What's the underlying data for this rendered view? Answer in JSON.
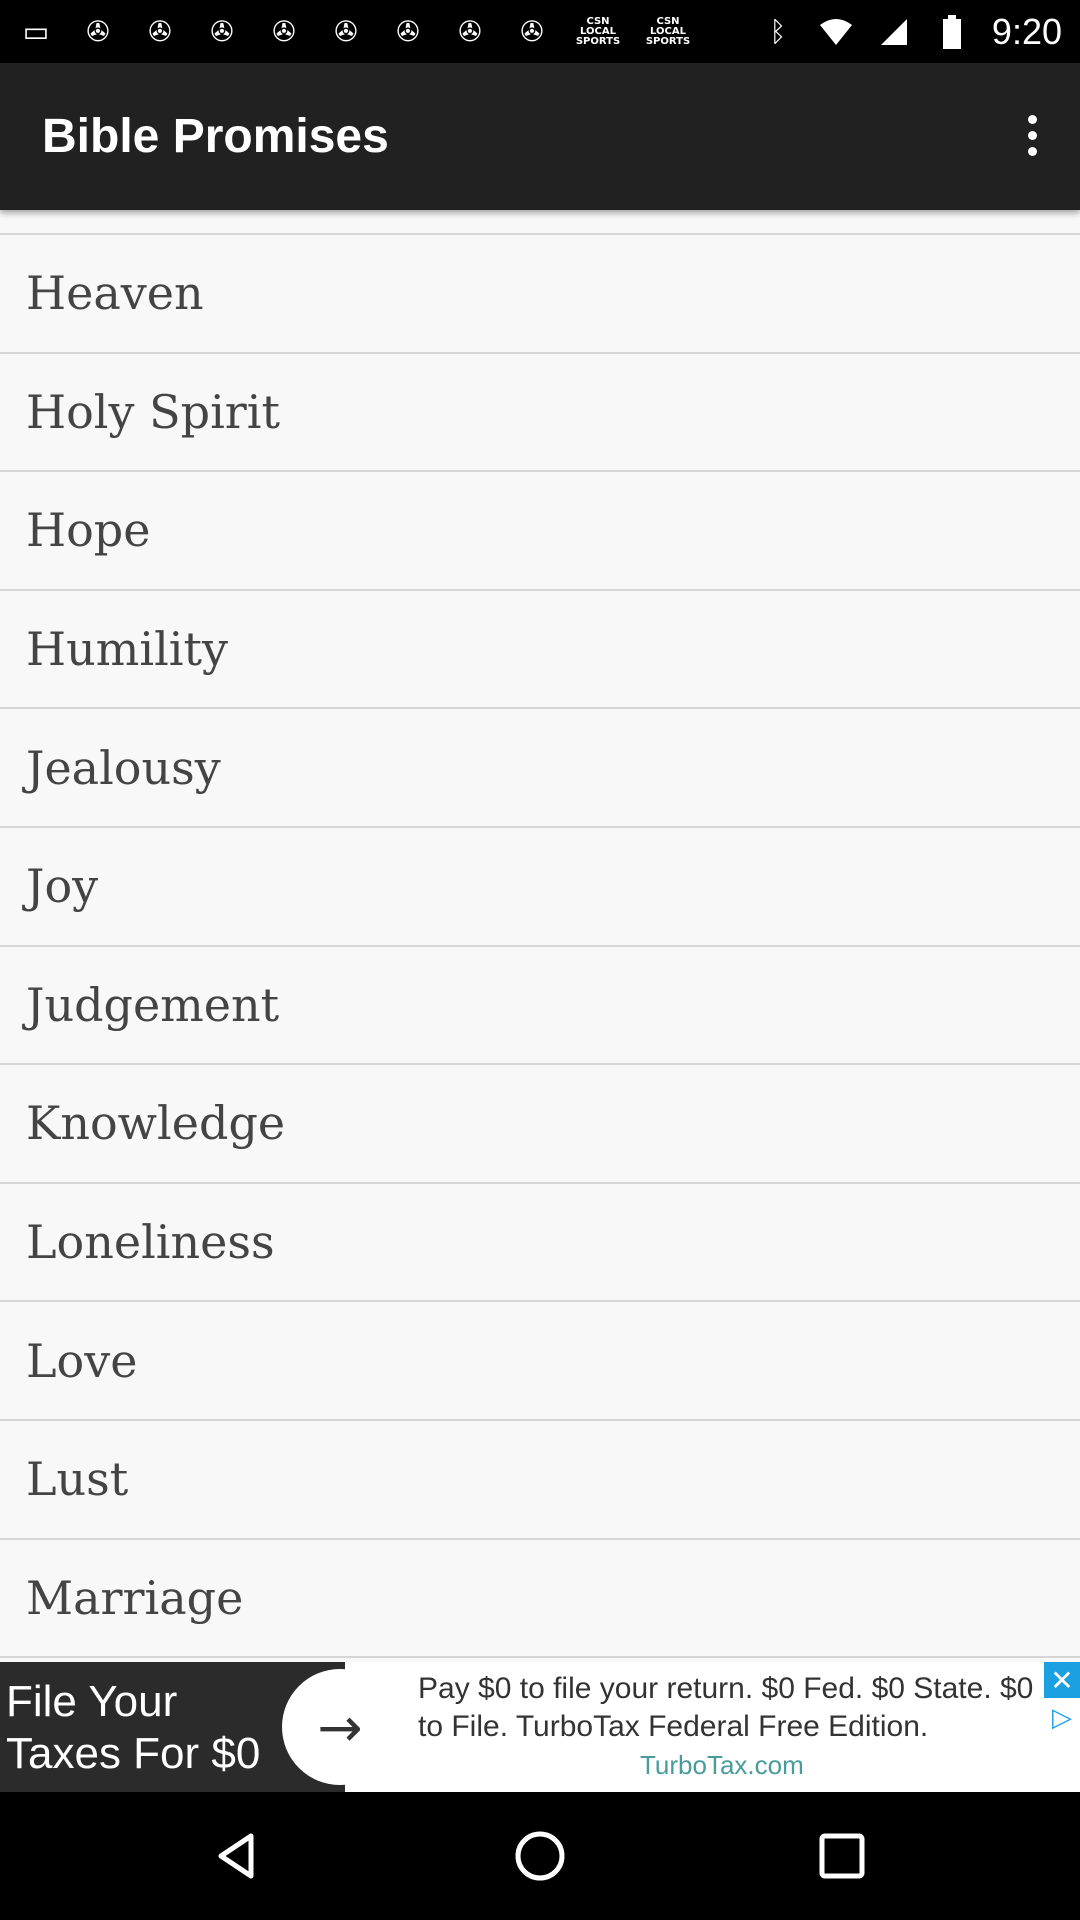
{
  "status_bar": {
    "time": "9:20",
    "left_icons": [
      "message-icon",
      "notification-icon",
      "notification-icon",
      "notification-icon",
      "notification-icon",
      "notification-icon",
      "notification-icon",
      "notification-icon",
      "notification-icon"
    ],
    "csn_label_1": "CSN LOCAL SPORTS",
    "csn_label_2": "CSN LOCAL SPORTS",
    "bluetooth_icon": "bluetooth-icon",
    "wifi_icon": "wifi-icon",
    "signal_icon": "signal-icon",
    "battery_icon": "battery-icon"
  },
  "app_bar": {
    "title": "Bible Promises",
    "overflow_icon": "more-vert-icon"
  },
  "list": {
    "items": [
      {
        "label": "Heaven"
      },
      {
        "label": "Holy Spirit"
      },
      {
        "label": "Hope"
      },
      {
        "label": "Humility"
      },
      {
        "label": "Jealousy"
      },
      {
        "label": "Joy"
      },
      {
        "label": "Judgement"
      },
      {
        "label": "Knowledge"
      },
      {
        "label": "Loneliness"
      },
      {
        "label": "Love"
      },
      {
        "label": "Lust"
      },
      {
        "label": "Marriage"
      }
    ]
  },
  "ad": {
    "headline": "File Your\nTaxes For $0",
    "body": "Pay $0 to file your return. $0 Fed. $0 State. $0 to File. TurboTax Federal Free Edition.",
    "domain": "TurboTax.com",
    "arrow_icon": "arrow-right-icon",
    "close_icon": "close-icon",
    "adchoices_icon": "adchoices-icon"
  },
  "nav_bar": {
    "back_icon": "back-icon",
    "home_icon": "home-icon",
    "recent_icon": "recent-apps-icon"
  },
  "colors": {
    "app_bar_bg": "#212121",
    "list_bg": "#f8f8f8",
    "divider": "#d6d6d6",
    "list_text": "#444444"
  }
}
